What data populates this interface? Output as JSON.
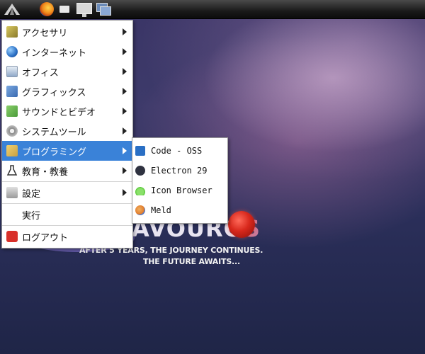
{
  "desktop": {
    "logo": {
      "main": "AVOURO",
      "accent": "S"
    },
    "tagline_1": "AFTER 5 YEARS, THE JOURNEY CONTINUES.",
    "tagline_2": "THE FUTURE AWAITS..."
  },
  "taskbar": {
    "icons": [
      "start-menu-icon",
      "firefox-icon",
      "file-manager-icon",
      "monitor-icon",
      "windows-icon"
    ]
  },
  "menu": {
    "items": [
      {
        "label": "アクセサリ",
        "icon": "accessories-icon",
        "color": "#8a7a2a",
        "submenu": true
      },
      {
        "label": "インターネット",
        "icon": "globe-icon",
        "color": "#2a6fc4",
        "submenu": true
      },
      {
        "label": "オフィス",
        "icon": "document-icon",
        "color": "#8fa9c8",
        "submenu": true
      },
      {
        "label": "グラフィックス",
        "icon": "graphics-icon",
        "color": "#3a6ab0",
        "submenu": true
      },
      {
        "label": "サウンドとビデオ",
        "icon": "music-icon",
        "color": "#4a9a3a",
        "submenu": true
      },
      {
        "label": "システムツール",
        "icon": "gear-icon",
        "color": "#8a8a8a",
        "submenu": true
      },
      {
        "label": "プログラミング",
        "icon": "programming-icon",
        "color": "#c8a040",
        "submenu": true,
        "active": true
      },
      {
        "label": "教育・教養",
        "icon": "flask-icon",
        "color": "#333333",
        "submenu": true
      },
      {
        "label": "設定",
        "icon": "settings-icon",
        "color": "#9a9a9a",
        "submenu": true
      },
      {
        "label": "実行",
        "icon": "",
        "color": "",
        "submenu": false
      },
      {
        "label": "ログアウト",
        "icon": "power-icon",
        "color": "#d8302a",
        "submenu": false
      }
    ]
  },
  "submenu": {
    "items": [
      {
        "label": "Code - OSS",
        "icon": "code-oss-icon",
        "color": "#2a6fc4"
      },
      {
        "label": "Electron 29",
        "icon": "electron-icon",
        "color": "#2f3240"
      },
      {
        "label": "Icon Browser",
        "icon": "icon-browser-icon",
        "color": "#5ac83a"
      },
      {
        "label": "Meld",
        "icon": "meld-icon",
        "color": "#e07a2a"
      }
    ]
  }
}
